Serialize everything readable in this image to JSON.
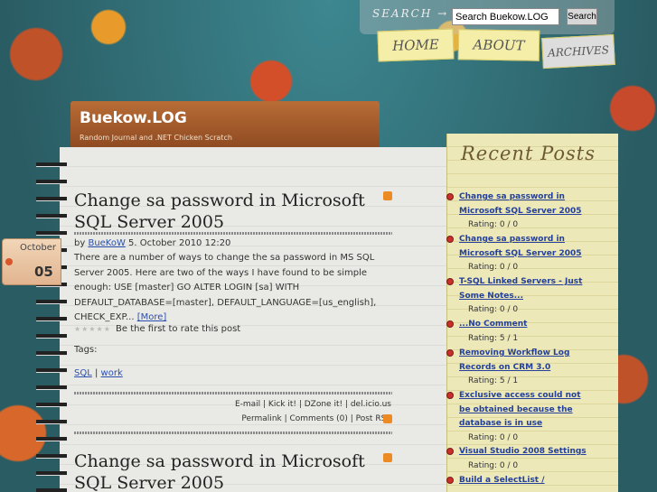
{
  "search": {
    "label": "SEARCH →",
    "value": "Search Buekow.LOG",
    "button": "Search"
  },
  "nav": {
    "home": "HOME",
    "about": "ABOUT",
    "archives": "ARCHIVES"
  },
  "blog": {
    "title": "Buekow.LOG",
    "subtitle": "Random Journal and .NET Chicken Scratch"
  },
  "date_tab": {
    "month": "October",
    "day": "05"
  },
  "post1": {
    "title": "Change sa password in Microsoft SQL Server 2005",
    "by": "by",
    "author": "BueKoW",
    "date": " 5. October 2010 12:20",
    "body": "There are a number of ways to change the sa password in MS SQL Server 2005.  Here are two of the ways I have found to be simple enough: USE [master] GO ALTER LOGIN [sa] WITH DEFAULT_DATABASE=[master], DEFAULT_LANGUAGE=[us_english], CHECK_EXP... ",
    "more": "[More]",
    "rating_text": "Be the first to rate this post",
    "tags_label": "Tags:",
    "tags": [
      "SQL",
      "work"
    ],
    "share_line1": "E-mail | Kick it! | DZone it! | del.icio.us",
    "share_line2": "Permalink | Comments (0) | Post RSS"
  },
  "post2": {
    "title": "Change sa password in Microsoft SQL Server 2005"
  },
  "sidebar": {
    "heading": "Recent Posts",
    "items": [
      {
        "title": "Change sa password in Microsoft SQL Server 2005",
        "rating": "Rating: 0 / 0"
      },
      {
        "title": "Change sa password in Microsoft SQL Server 2005",
        "rating": "Rating: 0 / 0"
      },
      {
        "title": "T-SQL Linked Servers - Just Some Notes...",
        "rating": "Rating: 0 / 0"
      },
      {
        "title": "...No Comment",
        "rating": "Rating: 5 / 1"
      },
      {
        "title": "Removing Workflow Log Records on CRM 3.0",
        "rating": "Rating: 5 / 1"
      },
      {
        "title": "Exclusive access could not be obtained because the database is in use",
        "rating": "Rating: 0 / 0"
      },
      {
        "title": "Visual Studio 2008 Settings",
        "rating": "Rating: 0 / 0"
      },
      {
        "title": "Build a SelectList /",
        "rating": ""
      }
    ]
  }
}
